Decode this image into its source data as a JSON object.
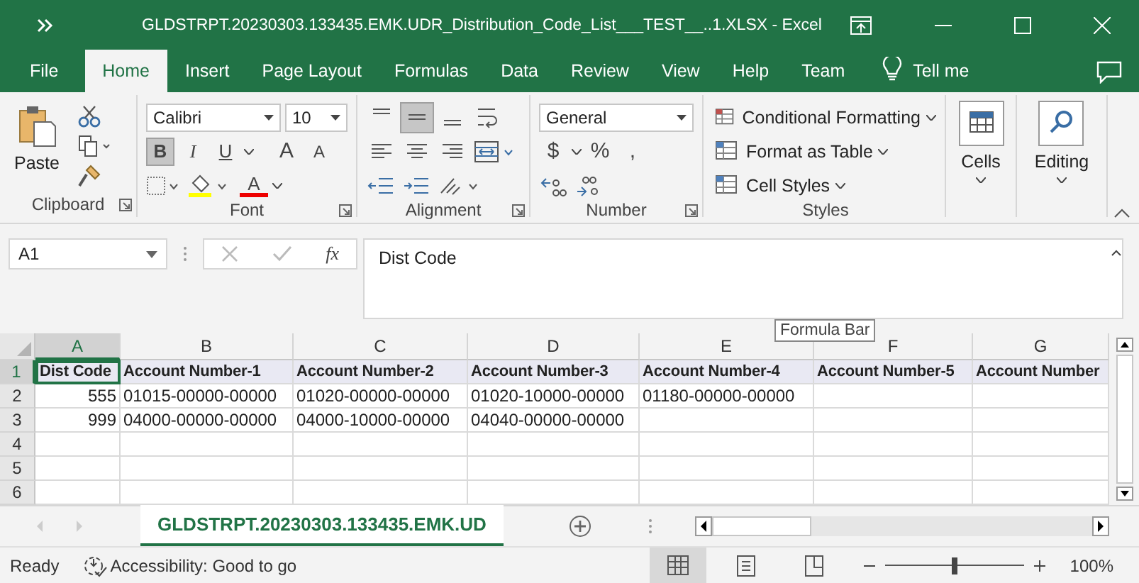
{
  "window": {
    "title": "GLDSTRPT.20230303.133435.EMK.UDR_Distribution_Code_List___TEST__..1.XLSX  -  Excel"
  },
  "tabs": [
    {
      "label": "File",
      "selected": false
    },
    {
      "label": "Home",
      "selected": true
    },
    {
      "label": "Insert",
      "selected": false
    },
    {
      "label": "Page Layout",
      "selected": false
    },
    {
      "label": "Formulas",
      "selected": false
    },
    {
      "label": "Data",
      "selected": false
    },
    {
      "label": "Review",
      "selected": false
    },
    {
      "label": "View",
      "selected": false
    },
    {
      "label": "Help",
      "selected": false
    },
    {
      "label": "Team",
      "selected": false
    }
  ],
  "tell_me": "Tell me",
  "ribbon": {
    "clipboard": {
      "paste": "Paste",
      "label": "Clipboard"
    },
    "font": {
      "name": "Calibri",
      "size": "10",
      "styles": [
        {
          "label": "B",
          "selected": true
        },
        {
          "label": "I",
          "selected": false
        },
        {
          "label": "U",
          "selected": false
        }
      ],
      "grow": "A",
      "shrink": "A",
      "color_letter": "A",
      "label": "Font"
    },
    "alignment": {
      "vertical": [
        {
          "selected": false
        },
        {
          "selected": true
        },
        {
          "selected": false
        }
      ],
      "label": "Alignment"
    },
    "number": {
      "format": "General",
      "currency": "$",
      "percent": "%",
      "comma": ",",
      "label": "Number"
    },
    "styles": {
      "items": [
        "Conditional Formatting",
        "Format as Table",
        "Cell Styles"
      ],
      "label": "Styles"
    },
    "cells": "Cells",
    "editing": "Editing"
  },
  "name_box": "A1",
  "fx": "fx",
  "formula": "Dist Code",
  "tooltip": "Formula Bar",
  "columns": [
    {
      "letter": "A",
      "selected": true
    },
    {
      "letter": "B",
      "selected": false
    },
    {
      "letter": "C",
      "selected": false
    },
    {
      "letter": "D",
      "selected": false
    },
    {
      "letter": "E",
      "selected": false
    },
    {
      "letter": "F",
      "selected": false
    },
    {
      "letter": "G",
      "selected": false
    }
  ],
  "rows": [
    {
      "number": "1",
      "selected": true,
      "kind": "header",
      "cells": [
        {
          "text": "Dist Code",
          "numeric": false
        },
        {
          "text": "Account Number-1",
          "numeric": false
        },
        {
          "text": "Account Number-2",
          "numeric": false
        },
        {
          "text": "Account Number-3",
          "numeric": false
        },
        {
          "text": "Account Number-4",
          "numeric": false
        },
        {
          "text": "Account Number-5",
          "numeric": false
        },
        {
          "text": "Account Number",
          "numeric": false
        }
      ]
    },
    {
      "number": "2",
      "selected": false,
      "kind": "data",
      "cells": [
        {
          "text": "555",
          "numeric": true
        },
        {
          "text": "01015-00000-00000",
          "numeric": false
        },
        {
          "text": "01020-00000-00000",
          "numeric": false
        },
        {
          "text": "01020-10000-00000",
          "numeric": false
        },
        {
          "text": "01180-00000-00000",
          "numeric": false
        }
      ]
    },
    {
      "number": "3",
      "selected": false,
      "kind": "data",
      "cells": [
        {
          "text": "999",
          "numeric": true
        },
        {
          "text": "04000-00000-00000",
          "numeric": false
        },
        {
          "text": "04000-10000-00000",
          "numeric": false
        },
        {
          "text": "04040-00000-00000",
          "numeric": false
        }
      ]
    },
    {
      "number": "4",
      "selected": false,
      "kind": "data",
      "cells": []
    },
    {
      "number": "5",
      "selected": false,
      "kind": "data",
      "cells": []
    },
    {
      "number": "6",
      "selected": false,
      "kind": "data",
      "cells": []
    }
  ],
  "sheet_tabs": [
    {
      "label": "GLDSTRPT.20230303.133435.EMK.UD",
      "selected": true
    }
  ],
  "status_bar": {
    "mode": "Ready",
    "accessibility": "Accessibility: Good to go",
    "views": [
      {
        "selected": true
      },
      {
        "selected": false
      },
      {
        "selected": false
      }
    ],
    "zoom": {
      "level": 0.5,
      "reading": "100%"
    }
  }
}
